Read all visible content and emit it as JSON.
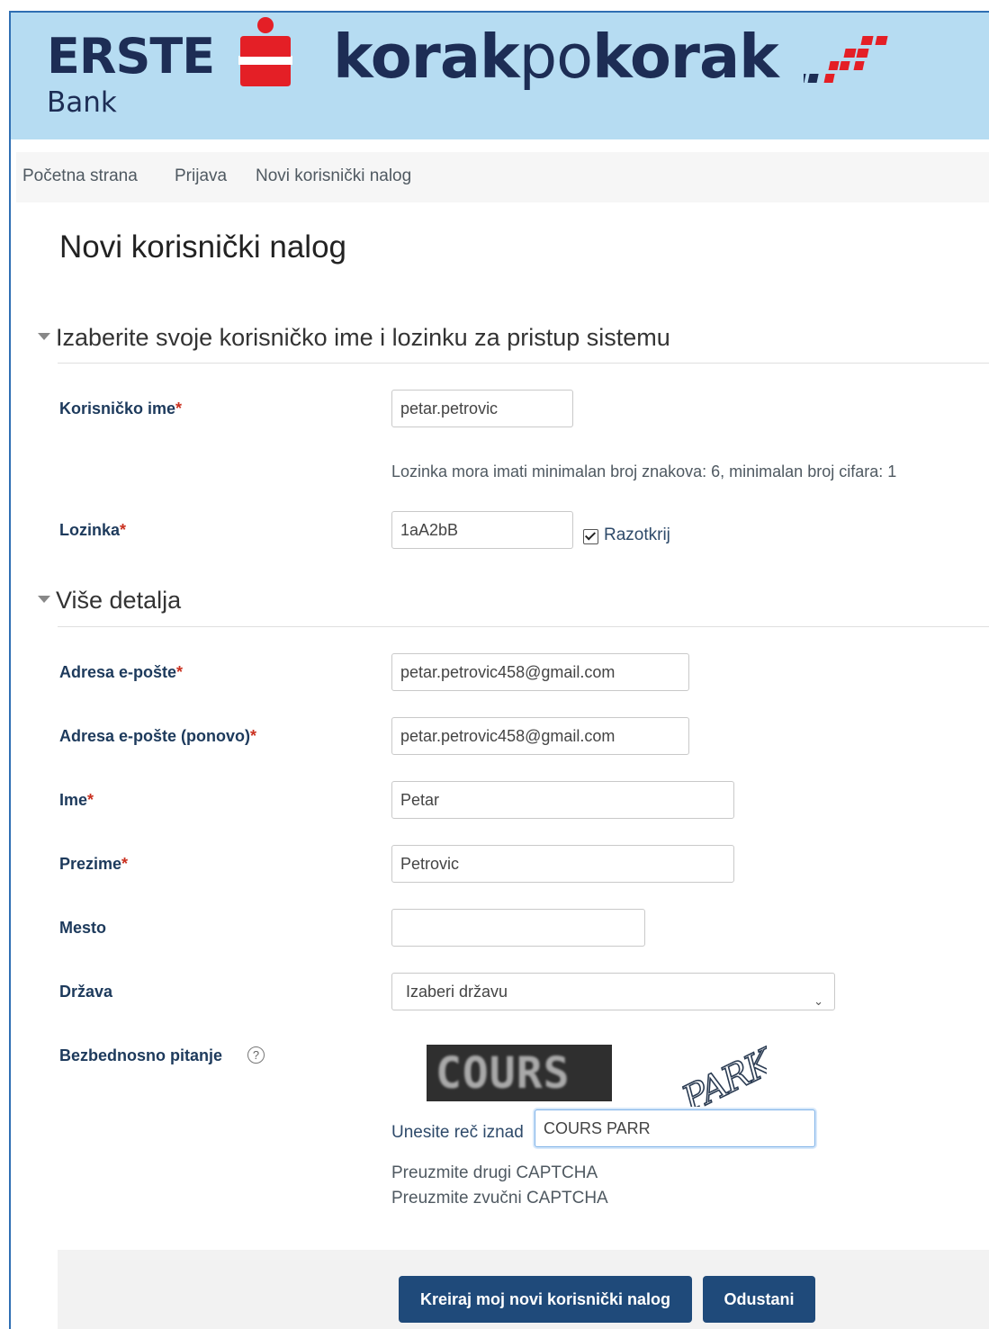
{
  "header": {
    "brand_top": "ERSTE",
    "brand_bottom": "Bank",
    "title_bold_1": "korak",
    "title_regular": "po",
    "title_bold_2": "korak"
  },
  "breadcrumb": {
    "items": [
      "Početna strana",
      "Prijava",
      "Novi korisnički nalog"
    ]
  },
  "page_title": "Novi korisnički nalog",
  "sections": {
    "account": {
      "title": "Izaberite svoje korisničko ime i lozinku za pristup sistemu"
    },
    "details": {
      "title": "Više detalja"
    }
  },
  "required_mark": "*",
  "form": {
    "username": {
      "label": "Korisničko ime",
      "value": "petar.petrovic"
    },
    "password_hint": "Lozinka mora imati minimalan broj znakova: 6, minimalan broj cifara: 1",
    "password": {
      "label": "Lozinka",
      "value": "1aA2bB",
      "reveal_label": "Razotkrij",
      "reveal_checked": true
    },
    "email": {
      "label": "Adresa e-pošte",
      "value": "petar.petrovic458@gmail.com"
    },
    "email_again": {
      "label": "Adresa e-pošte (ponovo)",
      "value": "petar.petrovic458@gmail.com"
    },
    "first_name": {
      "label": "Ime",
      "value": "Petar"
    },
    "last_name": {
      "label": "Prezime",
      "value": "Petrovic"
    },
    "city": {
      "label": "Mesto",
      "value": ""
    },
    "country": {
      "label": "Država",
      "selected": "Izaberi državu"
    },
    "captcha": {
      "label": "Bezbednosno pitanje",
      "help_icon": "question-circle-icon",
      "word_1": "COURS",
      "word_2": "PARK",
      "prompt": "Unesite reč iznad",
      "value": "COURS PARR",
      "link_new": "Preuzmite drugi CAPTCHA",
      "link_audio": "Preuzmite zvučni CAPTCHA"
    }
  },
  "buttons": {
    "submit": "Kreiraj moj novi korisnički nalog",
    "cancel": "Odustani"
  },
  "colors": {
    "header_bg": "#b6dcf2",
    "brand_navy": "#1d2d55",
    "brand_red": "#e41f26",
    "button_bg": "#1f4a7a",
    "required_red": "#ca3120"
  }
}
